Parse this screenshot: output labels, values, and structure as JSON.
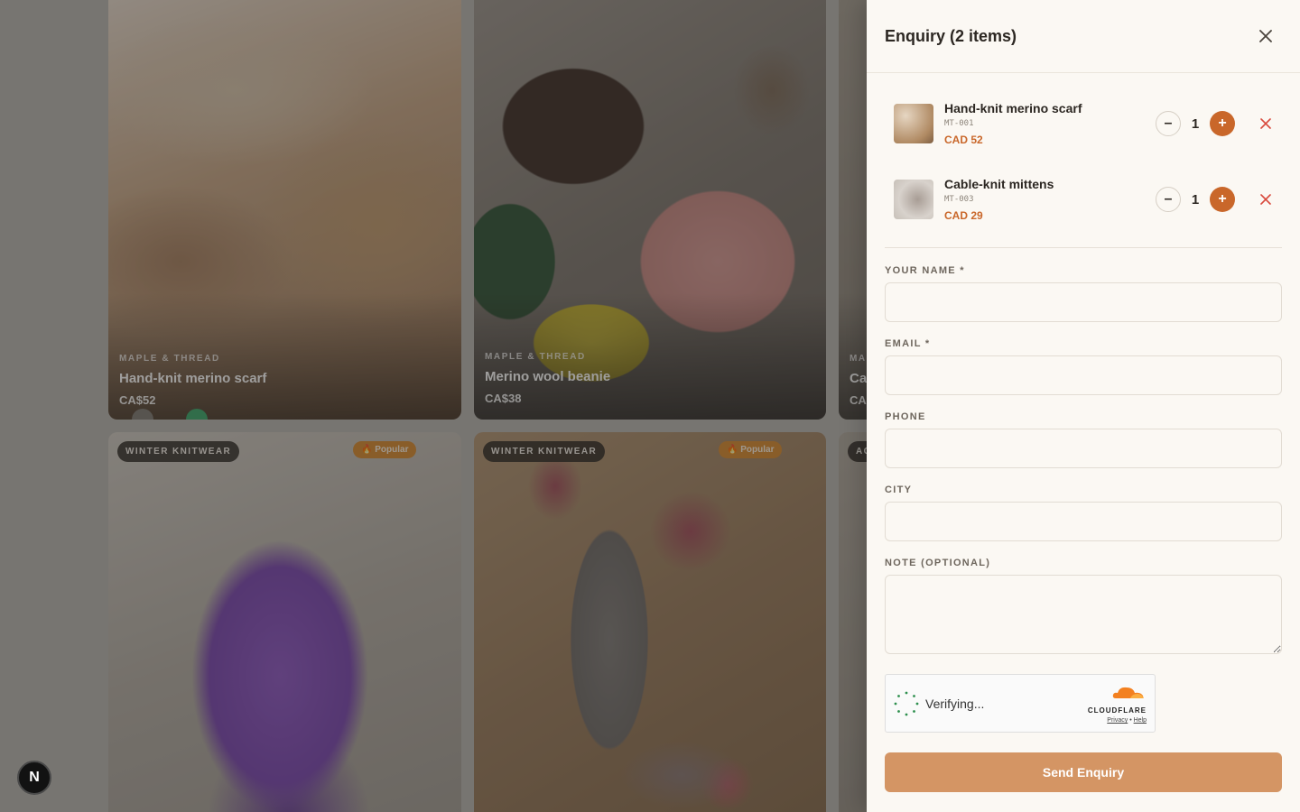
{
  "catalog": {
    "cards": [
      {
        "brand": "MAPLE & THREAD",
        "title": "Hand-knit merino scarf",
        "price": "CA$52"
      },
      {
        "brand": "MAPLE & THREAD",
        "title": "Merino wool beanie",
        "price": "CA$38"
      },
      {
        "brand": "MA",
        "title": "Ca",
        "price": "CA"
      }
    ],
    "row2": [
      {
        "category": "WINTER KNITWEAR",
        "badge": "🔥 Popular"
      },
      {
        "category": "WINTER KNITWEAR",
        "badge": "🔥 Popular"
      },
      {
        "category": "AC"
      }
    ],
    "dot_colors": [
      "#7f7a74",
      "#3aa86b"
    ]
  },
  "badge_letter": "N",
  "enquiry": {
    "title": "Enquiry (2 items)",
    "items": [
      {
        "name": "Hand-knit merino scarf",
        "sku": "MT-001",
        "price": "CAD 52",
        "qty": "1",
        "minus": "–",
        "plus": "+"
      },
      {
        "name": "Cable-knit mittens",
        "sku": "MT-003",
        "price": "CAD 29",
        "qty": "1",
        "minus": "–",
        "plus": "+"
      }
    ],
    "form": {
      "name_label": "YOUR NAME *",
      "email_label": "EMAIL *",
      "phone_label": "PHONE",
      "city_label": "CITY",
      "note_label": "NOTE (OPTIONAL)",
      "name_value": "",
      "email_value": "",
      "phone_value": "",
      "city_value": "",
      "note_value": ""
    },
    "captcha": {
      "status": "Verifying...",
      "brand": "CLOUDFLARE",
      "privacy": "Privacy",
      "separator": "•",
      "help": "Help"
    },
    "submit_label": "Send Enquiry"
  },
  "colors": {
    "accent": "#c9672a",
    "button": "#d49564",
    "panel_bg": "#fbf8f3"
  }
}
